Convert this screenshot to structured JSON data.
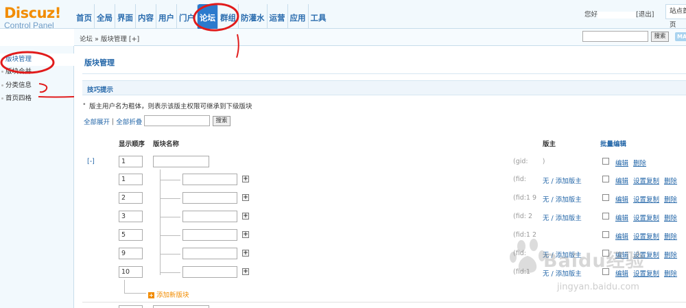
{
  "logo": {
    "brand": "Discuz!",
    "subtitle": "Control Panel"
  },
  "nav": [
    {
      "label": "首页"
    },
    {
      "label": "全局"
    },
    {
      "label": "界面"
    },
    {
      "label": "内容"
    },
    {
      "label": "用户"
    },
    {
      "label": "门户"
    },
    {
      "label": "论坛"
    },
    {
      "label": "群组"
    },
    {
      "label": "防灌水"
    },
    {
      "label": "运营"
    },
    {
      "label": "应用"
    },
    {
      "label": "工具"
    }
  ],
  "userbar": {
    "greeting": "您好",
    "logout": "[退出]",
    "site_button": "站点首页"
  },
  "breadcrumb": "论坛 » 版块管理  [+]",
  "header_search": {
    "button": "搜索",
    "map_button": "MAP"
  },
  "sidebar": [
    {
      "label": "版块管理",
      "active": true
    },
    {
      "label": "版块合并"
    },
    {
      "label": "分类信息"
    },
    {
      "label": "首页四格"
    }
  ],
  "main": {
    "title": "版块管理",
    "tips_title": "技巧提示",
    "tip": "版主用户名为粗体，则表示该版主权限可继承到下级版块",
    "expand_all": "全部展开",
    "collapse_all": "全部折叠",
    "search_button": "搜索",
    "columns": {
      "order": "显示顺序",
      "name": "版块名称",
      "moderator": "版主",
      "batch_edit": "批量编辑"
    },
    "root": {
      "expander": "[-]",
      "order": "1",
      "name": "",
      "id_text": "(gid:",
      "id_close": ")"
    },
    "rows": [
      {
        "order": "1",
        "fid": "(fid:",
        "moderator": "无 / 添加版主"
      },
      {
        "order": "2",
        "fid": "(fid:1  9",
        "moderator": "无 / 添加版主"
      },
      {
        "order": "3",
        "fid": "(fid:  2",
        "moderator": "无 / 添加版主"
      },
      {
        "order": "5",
        "fid": "(fid:1  2",
        "moderator": ""
      },
      {
        "order": "9",
        "fid": "(fid:",
        "moderator": "无 / 添加版主"
      },
      {
        "order": "10",
        "fid": "(fid:1",
        "moderator": "无 / 添加版主"
      }
    ],
    "actions": {
      "edit": "编辑",
      "copy": "设置复制",
      "delete": "删除"
    },
    "add_new": "添加新版块"
  },
  "watermark": {
    "text": "Baidu经验",
    "url": "jingyan.baidu.com"
  },
  "colors": {
    "accent": "#2b7acd",
    "brand": "#f28c00",
    "annotation": "#e11b1b"
  }
}
